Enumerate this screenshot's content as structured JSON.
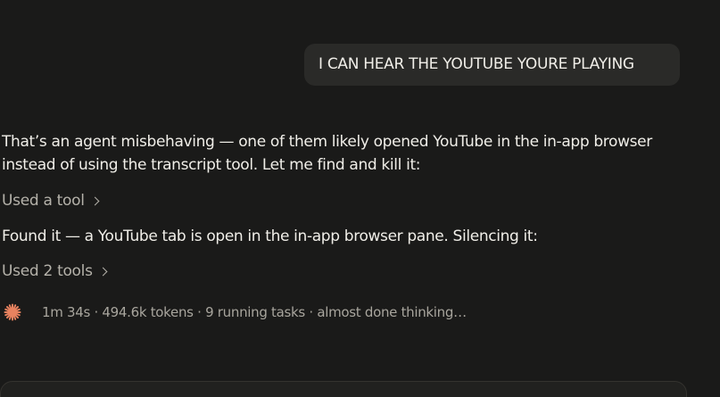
{
  "user_message": {
    "text": "I CAN HEAR THE YOUTUBE YOURE PLAYING"
  },
  "assistant": {
    "message_1": "That’s an agent misbehaving — one of them likely opened YouTube in the in-app browser instead of using the transcript tool. Let me find and kill it:",
    "tool_toggle_1": "Used a tool",
    "message_2": "Found it — a YouTube tab is open in the in-app browser pane. Silencing it:",
    "tool_toggle_2": "Used 2 tools"
  },
  "status": {
    "icon": "spark-icon",
    "icon_color": "#e8825f",
    "text": "1m 34s · 494.6k tokens · 9 running tasks · almost done thinking…"
  },
  "colors": {
    "background": "#1a1a19",
    "bubble": "#2a2a28",
    "muted_text": "#b5b2aa",
    "accent": "#e8825f"
  }
}
